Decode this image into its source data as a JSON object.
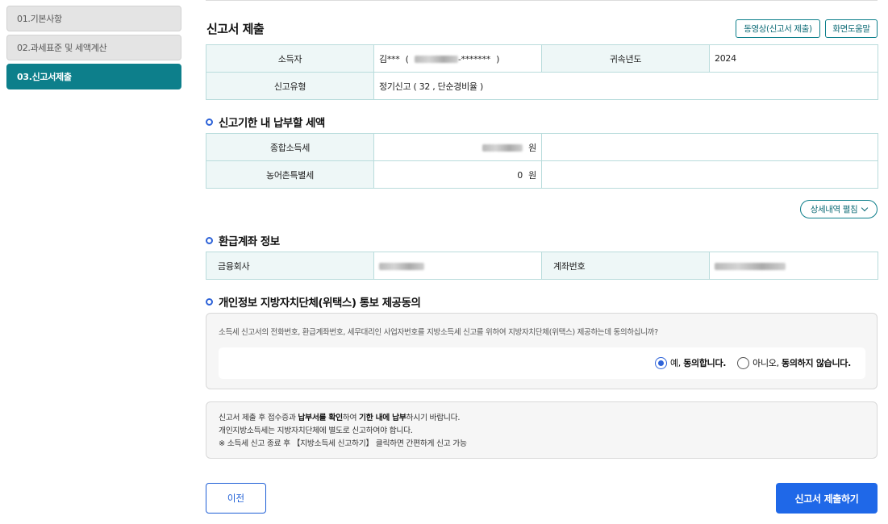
{
  "sidebar": {
    "items": [
      {
        "label": "01.기본사항",
        "active": false
      },
      {
        "label": "02.과세표준 및 세액계산",
        "active": false
      },
      {
        "label": "03.신고서제출",
        "active": true
      }
    ]
  },
  "header": {
    "title": "신고서 제출",
    "video_button": "동영상(신고서 제출)",
    "help_button": "화면도움말"
  },
  "filer_info": {
    "taxpayer_label": "소득자",
    "taxpayer_name": "김***",
    "taxpayer_id_open": "(",
    "taxpayer_id_masked": "-*******",
    "taxpayer_id_close": ")",
    "year_label": "귀속년도",
    "year_value": "2024",
    "type_label": "신고유형",
    "type_value": "정기신고 ( 32 , 단순경비율 )"
  },
  "tax_due": {
    "section_title": "신고기한 내 납부할 세액",
    "rows": [
      {
        "label": "종합소득세",
        "value": "",
        "unit": "원",
        "redacted": true
      },
      {
        "label": "농어촌특별세",
        "value": "0",
        "unit": "원",
        "redacted": false
      }
    ],
    "expand_button": "상세내역 펼침"
  },
  "refund_account": {
    "section_title": "환급계좌 정보",
    "bank_label": "금융회사",
    "account_label": "계좌번호"
  },
  "consent": {
    "section_title": "개인정보 지방자치단체(위택스) 통보 제공동의",
    "question": "소득세 신고서의 전화번호, 환급계좌번호, 세무대리인 사업자번호를 지방소득세 신고를 위하여 지방자치단체(위택스) 제공하는데 동의하십니까?",
    "yes_prefix": "예, ",
    "yes_bold": "동의합니다.",
    "no_prefix": "아니오, ",
    "no_bold": "동의하지 않습니다.",
    "selected": "yes"
  },
  "notice": {
    "line1_a": "신고서 제출 후 접수증과 ",
    "line1_b": "납부서를 확인",
    "line1_c": "하여 ",
    "line1_d": "기한 내에 납부",
    "line1_e": "하시기 바랍니다.",
    "line2": "개인지방소득세는 지방자치단체에 별도로 신고하여야 합니다.",
    "line3": "※ 소득세 신고 종료 후 【지방소득세 신고하기】 클릭하면 간편하게 신고 가능"
  },
  "footer": {
    "prev_button": "이전",
    "submit_button": "신고서 제출하기"
  },
  "colors": {
    "teal": "#0d7f8b",
    "primary_blue": "#1f68e8",
    "table_header_bg": "#eef7f7"
  }
}
